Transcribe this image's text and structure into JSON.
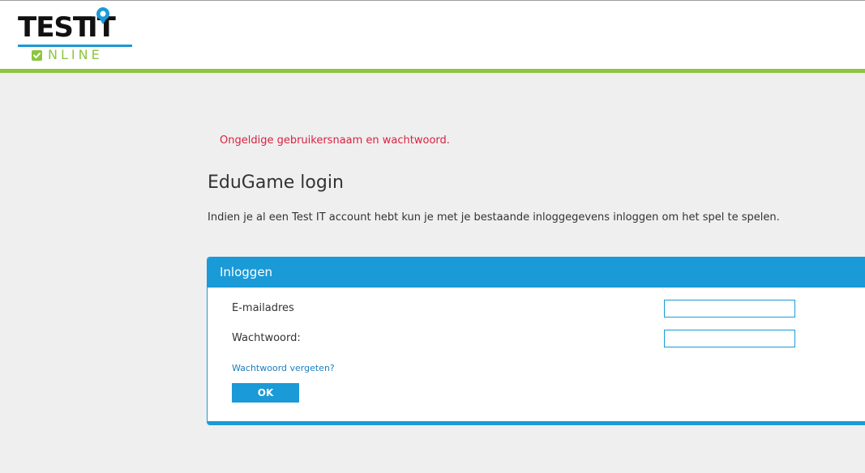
{
  "logo": {
    "word_test": "TEST",
    "word_it": "IT",
    "word_online": "NLINE",
    "colors": {
      "dark": "#111111",
      "blue": "#1a9ad7",
      "green": "#8dc63f"
    }
  },
  "colors": {
    "accent_green": "#8dc63f",
    "primary_blue": "#1a9ad7",
    "error_red": "#d9223f",
    "background": "#efefef"
  },
  "error_message": "Ongeldige gebruikersnaam en wachtwoord.",
  "page_title": "EduGame login",
  "intro_text": "Indien je al een Test IT account hebt kun je met je bestaande inloggegevens inloggen om het spel te spelen.",
  "login_panel": {
    "title": "Inloggen",
    "email_label": "E-mailadres",
    "email_value": "",
    "password_label": "Wachtwoord:",
    "password_value": "",
    "forgot_link": "Wachtwoord vergeten?",
    "submit_label": "OK"
  }
}
